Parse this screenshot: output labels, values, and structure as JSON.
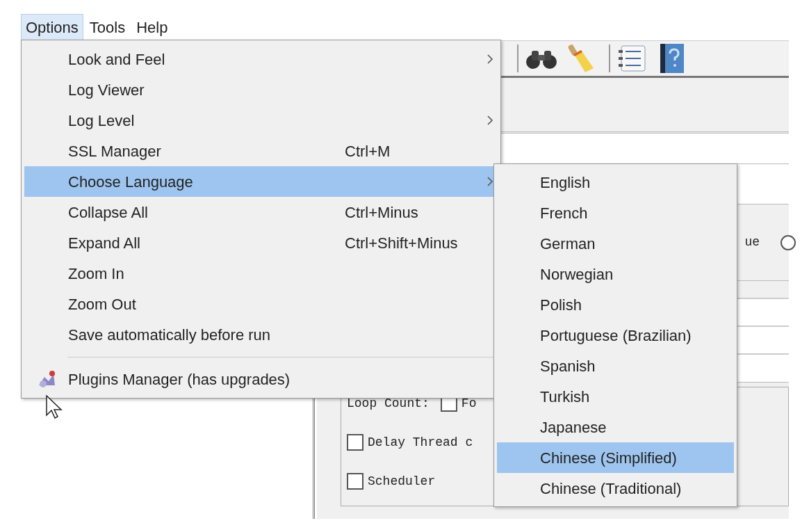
{
  "menu_bar": [
    {
      "label": "Options",
      "selected": true
    },
    {
      "label": "Tools",
      "selected": false
    },
    {
      "label": "Help",
      "selected": false
    }
  ],
  "options_menu": [
    {
      "kind": "item",
      "label": "Look and Feel",
      "submenu": true,
      "selected": false
    },
    {
      "kind": "item",
      "label": "Log Viewer",
      "submenu": false,
      "selected": false
    },
    {
      "kind": "item",
      "label": "Log Level",
      "submenu": true,
      "selected": false
    },
    {
      "kind": "item",
      "label": "SSL Manager",
      "shortcut": "Ctrl+M",
      "submenu": false,
      "selected": false
    },
    {
      "kind": "item",
      "label": "Choose Language",
      "submenu": true,
      "selected": true
    },
    {
      "kind": "item",
      "label": "Collapse All",
      "shortcut": "Ctrl+Minus",
      "submenu": false,
      "selected": false
    },
    {
      "kind": "item",
      "label": "Expand All",
      "shortcut": "Ctrl+Shift+Minus",
      "submenu": false,
      "selected": false
    },
    {
      "kind": "item",
      "label": "Zoom In",
      "submenu": false,
      "selected": false
    },
    {
      "kind": "item",
      "label": "Zoom Out",
      "submenu": false,
      "selected": false
    },
    {
      "kind": "item",
      "label": "Save automatically before run",
      "submenu": false,
      "selected": false
    },
    {
      "kind": "separator"
    },
    {
      "kind": "plugin-item",
      "label": "Plugins Manager (has upgrades)",
      "submenu": false,
      "selected": false
    }
  ],
  "language_menu": [
    {
      "label": "English",
      "selected": false
    },
    {
      "label": "French",
      "selected": false
    },
    {
      "label": "German",
      "selected": false
    },
    {
      "label": "Norwegian",
      "selected": false
    },
    {
      "label": "Polish",
      "selected": false
    },
    {
      "label": "Portuguese (Brazilian)",
      "selected": false
    },
    {
      "label": "Spanish",
      "selected": false
    },
    {
      "label": "Turkish",
      "selected": false
    },
    {
      "label": "Japanese",
      "selected": false
    },
    {
      "label": "Chinese (Simplified)",
      "selected": true
    },
    {
      "label": "Chinese (Traditional)",
      "selected": false
    }
  ],
  "background": {
    "value_option": {
      "label": "ue",
      "selected": false
    },
    "loop_count": {
      "label": "Loop Count:",
      "checkbox": {
        "label": "Fo",
        "checked": false
      }
    },
    "checkboxes": [
      {
        "label": "Delay Thread c",
        "checked": false
      },
      {
        "label": "Scheduler",
        "checked": false
      }
    ]
  }
}
